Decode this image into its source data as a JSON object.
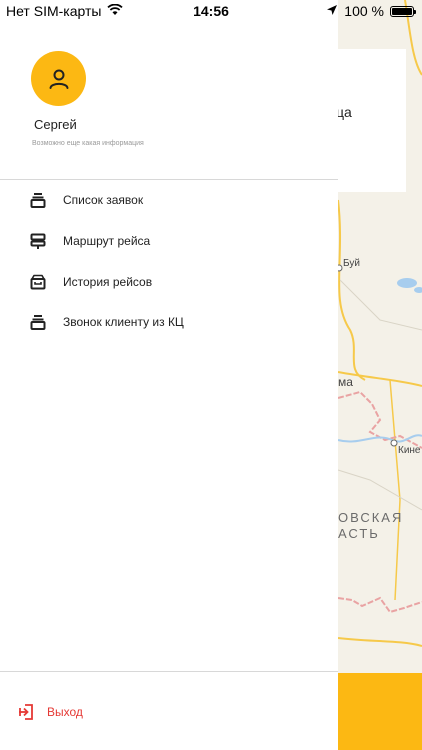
{
  "status_bar": {
    "carrier": "Нет SIM-карты",
    "time": "14:56",
    "battery": "100 %"
  },
  "profile": {
    "name": "Сергей",
    "info": "Возможно еще какая информация"
  },
  "menu": {
    "items": [
      {
        "label": "Список заявок",
        "icon": "stack-icon"
      },
      {
        "label": "Маршрут рейса",
        "icon": "signpost-icon"
      },
      {
        "label": "История рейсов",
        "icon": "archive-box-icon"
      },
      {
        "label": "Звонок клиенту из КЦ",
        "icon": "stack-icon"
      }
    ]
  },
  "logout": {
    "label": "Выход",
    "icon": "logout-icon"
  },
  "map": {
    "card_text": "ца",
    "places": [
      "Буй",
      "ма",
      "Кине"
    ],
    "region_lines": [
      "ОВСКАЯ",
      "АСТЬ"
    ]
  },
  "colors": {
    "accent": "#fcb813",
    "danger": "#e53935",
    "map_background": "#f4f1e8",
    "map_road": "#f6c94a",
    "map_border": "#e9a3a3",
    "map_water": "#a7cdee"
  }
}
